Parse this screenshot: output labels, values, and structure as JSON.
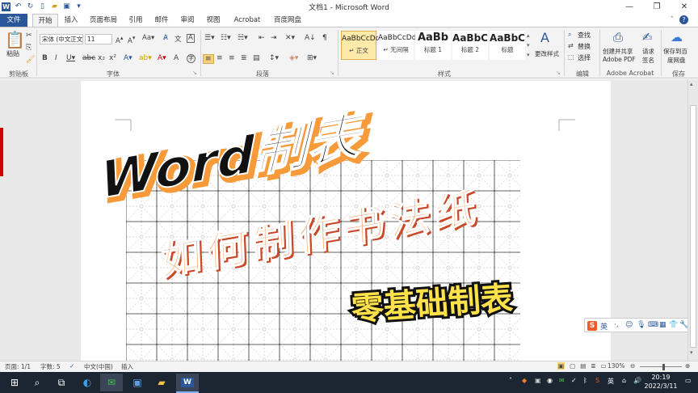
{
  "app": {
    "title": "文档1 - Microsoft Word",
    "accent": "#2b579a"
  },
  "qat": {
    "icons": [
      "word-logo-icon",
      "undo-icon",
      "redo-icon",
      "new-doc-icon",
      "open-icon",
      "save-icon",
      "customize-icon"
    ]
  },
  "tabs": [
    "文件",
    "开始",
    "插入",
    "页面布局",
    "引用",
    "邮件",
    "审阅",
    "视图",
    "Acrobat",
    "百度网盘"
  ],
  "ribbon": {
    "clipboard": {
      "paste": "粘贴",
      "label": "剪贴板"
    },
    "font": {
      "name": "宋体 (中文正文)",
      "size": "11",
      "label": "字体"
    },
    "paragraph": {
      "label": "段落"
    },
    "styles": {
      "items": [
        {
          "preview": "AaBbCcDd",
          "name": "↵ 正文"
        },
        {
          "preview": "AaBbCcDd",
          "name": "↵ 无间隔"
        },
        {
          "preview": "AaBb",
          "name": "标题 1"
        },
        {
          "preview": "AaBbC",
          "name": "标题 2"
        },
        {
          "preview": "AaBbC",
          "name": "标题"
        }
      ],
      "change": "更改样式",
      "label": "样式"
    },
    "editing": {
      "find": "查找",
      "replace": "替换",
      "select": "选择",
      "label": "编辑"
    },
    "acrobat": {
      "create": "创建并共享",
      "create2": "Adobe PDF",
      "request": "请求",
      "request2": "签名",
      "label": "Adobe Acrobat"
    },
    "save": {
      "line1": "保存到百",
      "line2": "度网盘",
      "label": "保存"
    }
  },
  "document": {
    "banner_title": "Word制表",
    "banner_subtitle": "如何制作书法纸",
    "banner_tag": "零基础制表"
  },
  "ime": {
    "lang": "英"
  },
  "status": {
    "page": "页面: 1/1",
    "words": "字数: 5",
    "lang": "中文(中国)",
    "mode": "插入",
    "zoom": "130%"
  },
  "taskbar": {
    "time": "20:19",
    "date": "2022/3/11",
    "ime": "英"
  }
}
